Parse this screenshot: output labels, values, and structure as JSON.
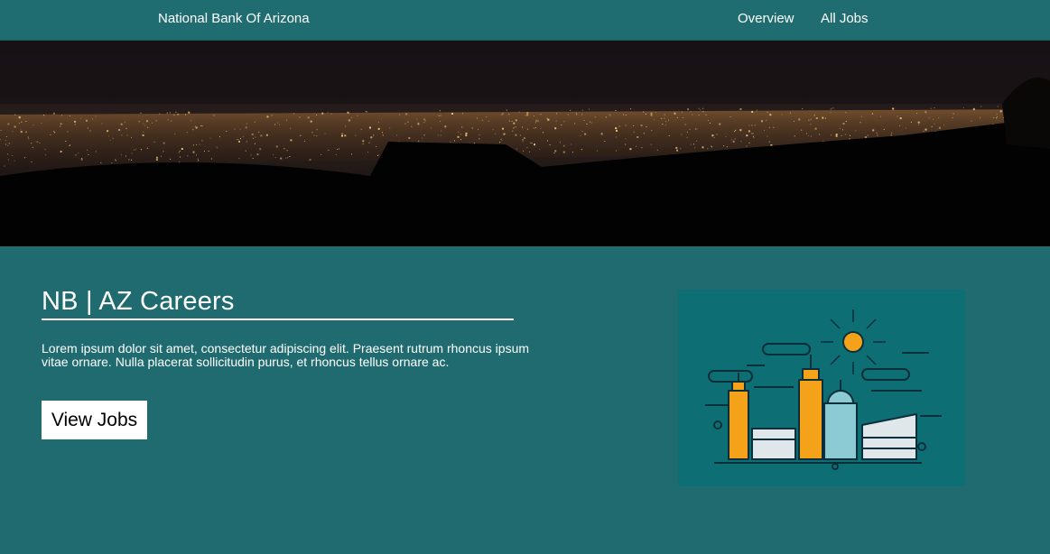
{
  "nav": {
    "brand": "National Bank Of Arizona",
    "links": [
      "Overview",
      "All Jobs"
    ]
  },
  "hero": {
    "alt": "Night city skyline panorama"
  },
  "main": {
    "title": "NB | AZ Careers",
    "intro": "Lorem ipsum dolor sit amet, consectetur adipiscing elit. Praesent rutrum rhoncus ipsum vitae ornare. Nulla placerat sollicitudin purus, et rhoncus tellus ornare ac.",
    "cta_label": "View Jobs"
  },
  "colors": {
    "page_bg": "#1f6b6f",
    "nav_bg": "#206d71",
    "card_bg": "#0d6e73",
    "accent_orange": "#f5a21b"
  },
  "icons": [
    "city-skyline-illustration",
    "sun-icon"
  ]
}
